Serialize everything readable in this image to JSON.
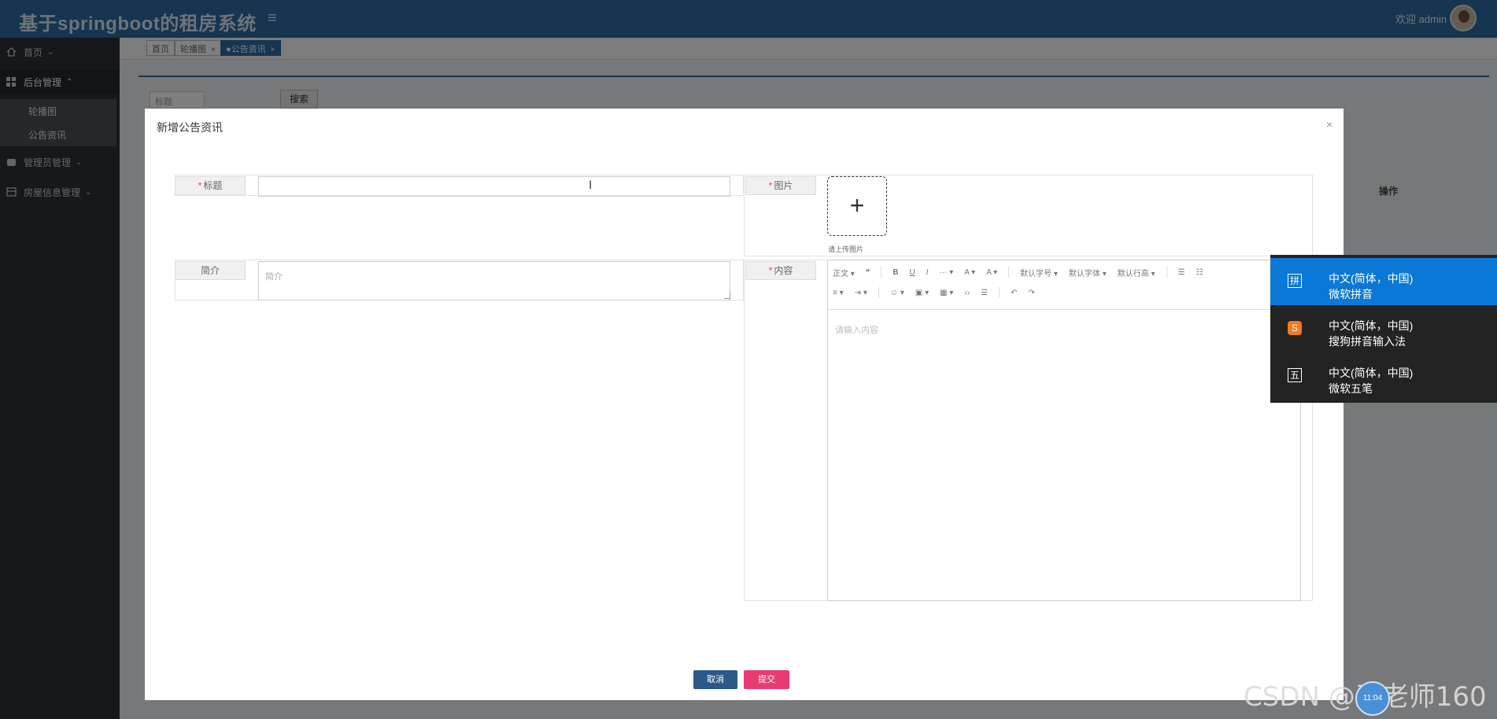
{
  "app": {
    "title": "基于springboot的租房系统",
    "welcome": "欢迎 admin"
  },
  "sidebar": {
    "items": [
      {
        "label": "首页",
        "icon": "home-icon"
      },
      {
        "label": "后台管理",
        "icon": "grid-icon",
        "expanded": true,
        "children": [
          {
            "label": "轮播图"
          },
          {
            "label": "公告资讯"
          }
        ]
      },
      {
        "label": "管理员管理",
        "icon": "users-icon"
      },
      {
        "label": "房屋信息管理",
        "icon": "house-icon"
      }
    ]
  },
  "tabs": [
    {
      "label": "首页"
    },
    {
      "label": "轮播图"
    },
    {
      "label": "●公告资讯",
      "active": true
    }
  ],
  "background": {
    "search_placeholder": "标题",
    "search_button": "搜索",
    "table_op_header": "操作"
  },
  "modal": {
    "title": "新增公告资讯",
    "fields": {
      "title_label": "标题",
      "image_label": "图片",
      "upload_tip": "请上传图片",
      "summary_label": "简介",
      "summary_placeholder": "简介",
      "content_label": "内容",
      "content_placeholder": "请输入内容"
    },
    "toolbar": {
      "row1": [
        "正文",
        "❝",
        "B",
        "U",
        "I",
        "···",
        "A",
        "A",
        "默认字号",
        "默认字体",
        "默认行高",
        "☰",
        "☷"
      ],
      "row2": [
        "≡",
        "⇥",
        "☺",
        "▣",
        "▦",
        "‹›",
        "☰",
        "↶",
        "↷"
      ]
    },
    "cancel_label": "取消",
    "submit_label": "提交"
  },
  "ime": {
    "options": [
      {
        "line1": "中文(简体，中国)",
        "line2": "微软拼音",
        "icon": "拼",
        "selected": true
      },
      {
        "line1": "中文(简体，中国)",
        "line2": "搜狗拼音输入法",
        "icon": "S",
        "selected": false
      },
      {
        "line1": "中文(简体，中国)",
        "line2": "微软五笔",
        "icon": "五",
        "selected": false
      }
    ]
  },
  "watermark": "CSDN @王老师160",
  "clock": "11:04"
}
